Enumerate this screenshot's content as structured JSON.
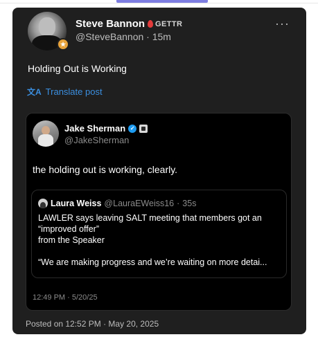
{
  "post": {
    "author_name": "Steve Bannon",
    "brand": "GETTR",
    "handle": "@SteveBannon",
    "time": "15m",
    "text": "Holding Out is Working",
    "translate_label": "Translate post",
    "posted_label": "Posted on 12:52 PM · May 20, 2025"
  },
  "quoted": {
    "author_name": "Jake Sherman",
    "handle": "@JakeSherman",
    "text": "the holding out is working, clearly.",
    "time": "12:49 PM · 5/20/25"
  },
  "inner_quote": {
    "author_name": "Laura Weiss",
    "handle": "@LauraEWeiss16",
    "time": "35s",
    "lines": [
      "LAWLER says leaving SALT meeting that members got an",
      "“improved offer”",
      "from the Speaker",
      "",
      "“We are making progress and we’re waiting on more detai..."
    ]
  },
  "colors": {
    "card_bg": "#1f1f1f",
    "quote_bg": "#000000",
    "link_blue": "#3b8fe0",
    "gettr_red": "#e23b3b",
    "verified_blue": "#1d9bf0"
  },
  "icons": [
    "more-icon",
    "translate-icon",
    "verified-icon",
    "gettr-icon",
    "affiliation-icon"
  ]
}
